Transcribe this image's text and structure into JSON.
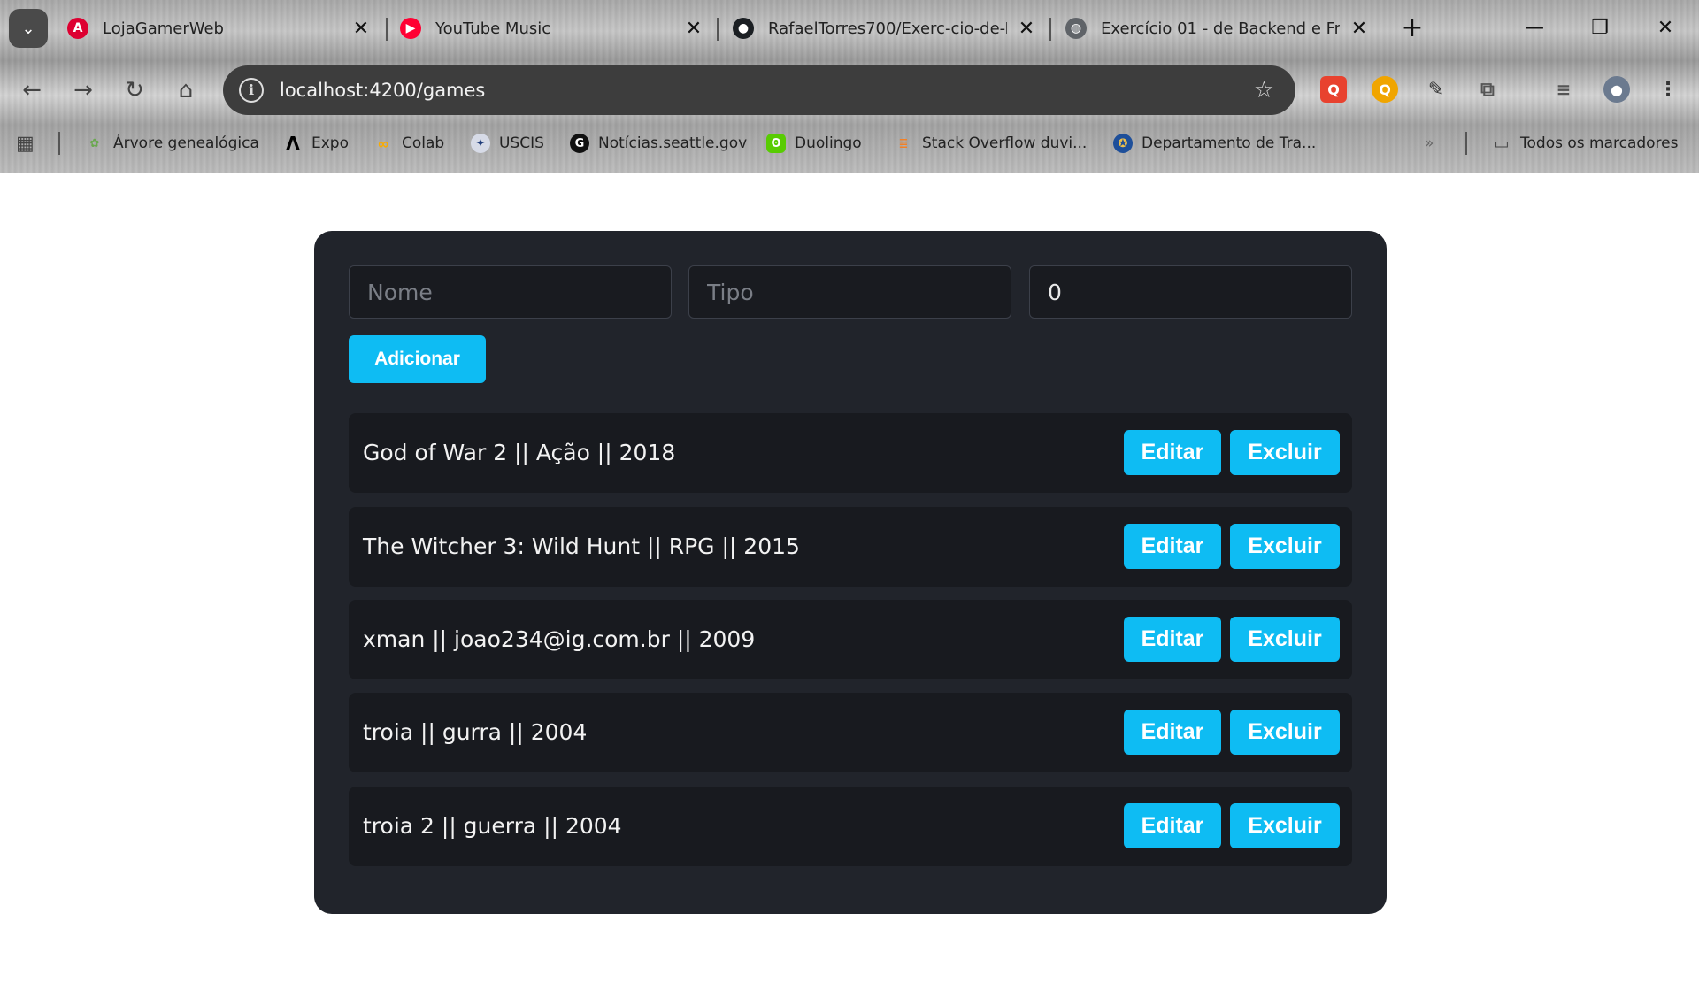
{
  "browser": {
    "tabs": [
      {
        "title": "LojaGamerWeb",
        "icon": "angular-icon",
        "active": true
      },
      {
        "title": "YouTube Music",
        "icon": "youtube-music-icon"
      },
      {
        "title": "RafaelTorres700/Exerc-cio-de-Ba",
        "icon": "github-icon"
      },
      {
        "title": "Exercício 01 - de Backend e Fro",
        "icon": "globe-icon"
      }
    ],
    "url": "localhost:4200/games",
    "bookmarks": [
      {
        "label": "Árvore genealógica",
        "icon": "family-tree-icon"
      },
      {
        "label": "Expo",
        "icon": "expo-icon"
      },
      {
        "label": "Colab",
        "icon": "colab-icon"
      },
      {
        "label": "USCIS",
        "icon": "uscis-seal-icon"
      },
      {
        "label": "Notícias.seattle.gov",
        "icon": "g-icon"
      },
      {
        "label": "Duolingo",
        "icon": "duolingo-icon"
      },
      {
        "label": "Stack Overflow duvi...",
        "icon": "stackoverflow-icon"
      },
      {
        "label": "Departamento de Tra...",
        "icon": "department-seal-icon"
      }
    ],
    "all_bookmarks_label": "Todos os marcadores"
  },
  "form": {
    "name_placeholder": "Nome",
    "type_placeholder": "Tipo",
    "year_value": "0",
    "add_label": "Adicionar"
  },
  "games": [
    {
      "text": "God of War 2 || Ação || 2018",
      "edit_label": "Editar",
      "delete_label": "Excluir"
    },
    {
      "text": "The Witcher 3: Wild Hunt || RPG || 2015",
      "edit_label": "Editar",
      "delete_label": "Excluir"
    },
    {
      "text": "xman || joao234@ig.com.br || 2009",
      "edit_label": "Editar",
      "delete_label": "Excluir"
    },
    {
      "text": "troia || gurra || 2004",
      "edit_label": "Editar",
      "delete_label": "Excluir"
    },
    {
      "text": "troia 2 || guerra || 2004",
      "edit_label": "Editar",
      "delete_label": "Excluir"
    }
  ],
  "colors": {
    "panel": "#21242b",
    "row": "#181a1f",
    "accent": "#0ebcf3"
  }
}
